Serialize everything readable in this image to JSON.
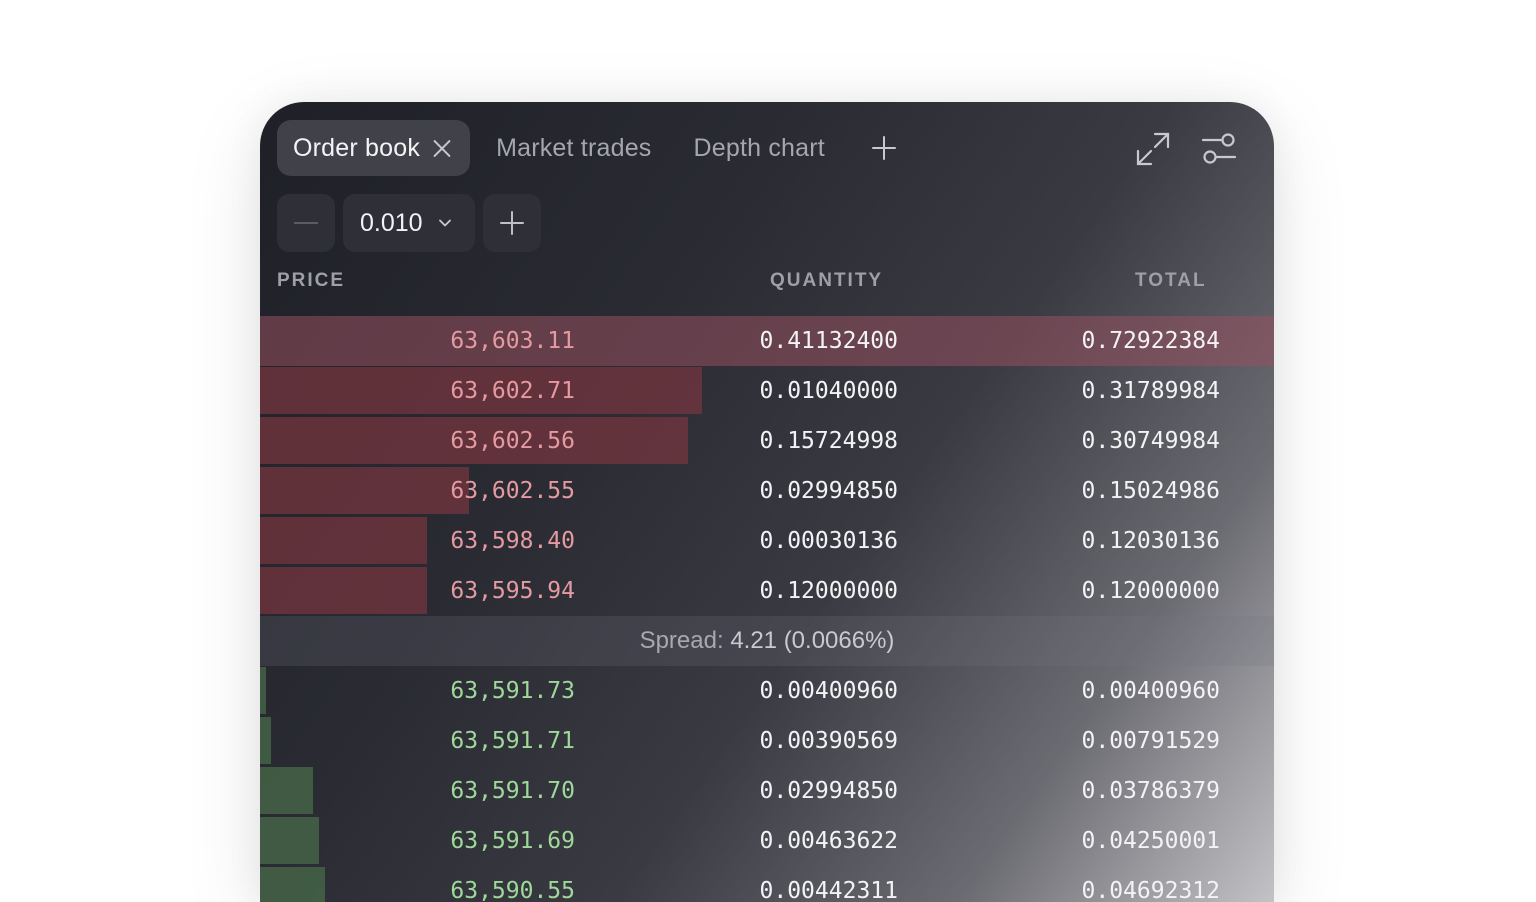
{
  "tabs": {
    "active": {
      "label": "Order book"
    },
    "others": [
      {
        "label": "Market trades"
      },
      {
        "label": "Depth chart"
      }
    ],
    "icons": {
      "close": "close-icon",
      "add": "plus-icon",
      "expand": "expand-icon",
      "settings": "sliders-icon"
    }
  },
  "controls": {
    "precision_value": "0.010",
    "decrease": "minus-icon",
    "increase": "plus-icon"
  },
  "columns": {
    "price": "PRICE",
    "quantity": "QUANTITY",
    "total": "TOTAL"
  },
  "asks": [
    {
      "price": "63,603.11",
      "quantity": "0.41132400",
      "total": "0.72922384",
      "depth": 1.0
    },
    {
      "price": "63,602.71",
      "quantity": "0.01040000",
      "total": "0.31789984",
      "depth": 0.436
    },
    {
      "price": "63,602.56",
      "quantity": "0.15724998",
      "total": "0.30749984",
      "depth": 0.422
    },
    {
      "price": "63,602.55",
      "quantity": "0.02994850",
      "total": "0.15024986",
      "depth": 0.206
    },
    {
      "price": "63,598.40",
      "quantity": "0.00030136",
      "total": "0.12030136",
      "depth": 0.165
    },
    {
      "price": "63,595.94",
      "quantity": "0.12000000",
      "total": "0.12000000",
      "depth": 0.165
    }
  ],
  "spread": {
    "label": "Spread:",
    "value": "4.21 (0.0066%)"
  },
  "bids": [
    {
      "price": "63,591.73",
      "quantity": "0.00400960",
      "total": "0.00400960",
      "depth": 0.006
    },
    {
      "price": "63,591.71",
      "quantity": "0.00390569",
      "total": "0.00791529",
      "depth": 0.011
    },
    {
      "price": "63,591.70",
      "quantity": "0.02994850",
      "total": "0.03786379",
      "depth": 0.052
    },
    {
      "price": "63,591.69",
      "quantity": "0.00463622",
      "total": "0.04250001",
      "depth": 0.058
    },
    {
      "price": "63,590.55",
      "quantity": "0.00442311",
      "total": "0.04692312",
      "depth": 0.064
    }
  ],
  "colors": {
    "ask_price": "#e59aa1",
    "bid_price": "#9ed99a",
    "ask_bar": "#783640",
    "bid_bar": "#466848"
  }
}
